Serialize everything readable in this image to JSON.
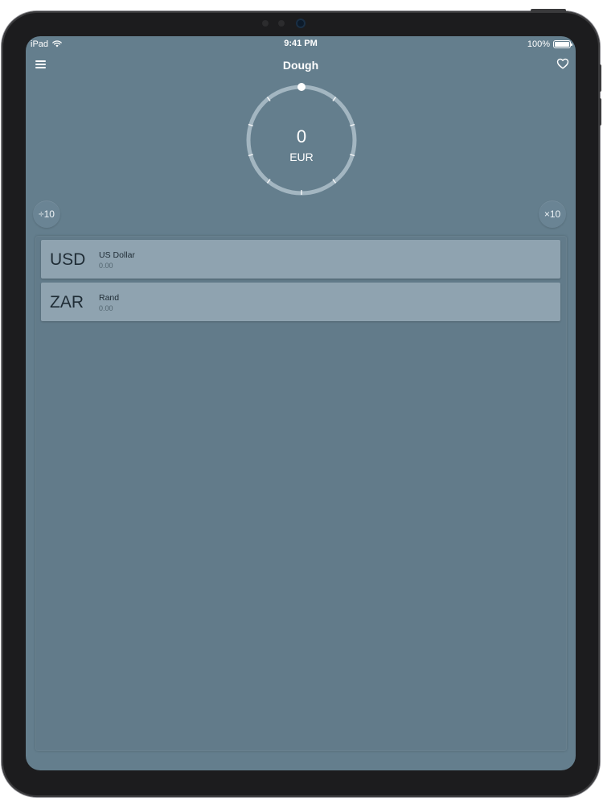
{
  "status_bar": {
    "device": "iPad",
    "time": "9:41 PM",
    "battery": "100%"
  },
  "nav": {
    "title": "Dough"
  },
  "dial": {
    "value": "0",
    "currency": "EUR"
  },
  "actions": {
    "divide_label": "÷10",
    "multiply_label": "×10"
  },
  "currencies": [
    {
      "code": "USD",
      "name": "US Dollar",
      "value": "0.00"
    },
    {
      "code": "ZAR",
      "name": "Rand",
      "value": "0.00"
    }
  ],
  "colors": {
    "screen_bg": "#647e8d",
    "row_bg": "#8fa3b0",
    "row_text": "#1f2c35"
  },
  "icons": {
    "menu": "menu-icon",
    "favorite": "heart-icon",
    "wifi": "wifi-icon",
    "battery": "battery-icon"
  }
}
